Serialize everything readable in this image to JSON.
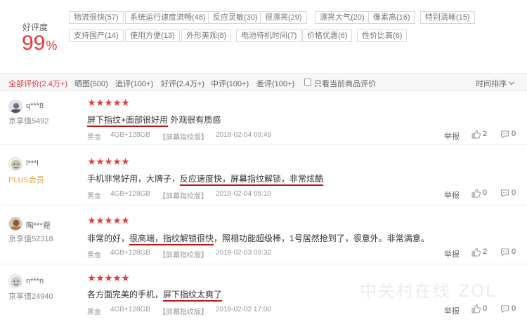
{
  "summary": {
    "rate_label": "好评度",
    "rate_value": "99",
    "rate_unit": "%",
    "tags": [
      {
        "label": "物流很快(57)"
      },
      {
        "label": "系统运行速度流畅(48)"
      },
      {
        "label": "反应灵敏(30)"
      },
      {
        "label": "很漂亮(29)"
      },
      {
        "label": "漂亮大气(20)"
      },
      {
        "label": "像素高(16)"
      },
      {
        "label": "特别清晰(15)"
      },
      {
        "label": "支持国产(14)"
      },
      {
        "label": "使用方便(13)"
      },
      {
        "label": "外形美观(8)"
      },
      {
        "label": "电池待机时间(7)"
      },
      {
        "label": "价格优惠(6)"
      },
      {
        "label": "性价比高(6)"
      }
    ]
  },
  "filters": {
    "all": "全部评价(2.4万+)",
    "photos": "晒图(500)",
    "followup": "追评(100+)",
    "good": "好评(2.4万+)",
    "medium": "中评(100+)",
    "bad": "差评(100+)",
    "current_only": "只看当前商品评价",
    "sort": "时间排序"
  },
  "reviews": [
    {
      "username": "q***8",
      "score": "京享值5492",
      "content_pre": "",
      "content_hl": "屏下指纹+面部很好用",
      "content_post": " 外观很有质感",
      "color": "黑金",
      "spec": "4GB+128GB",
      "edition": "【屏幕指纹版】",
      "date": "2018-02-04 09:49",
      "report": "举报",
      "likes": "2",
      "comments": "0"
    },
    {
      "username": "l***l",
      "score": "PLUS会员",
      "content_pre": "手机非常好用，大牌子，",
      "content_hl": "反应速度快，屏幕指纹解锁，非常炫酷",
      "content_post": "",
      "color": "黑金",
      "spec": "4GB+128GB",
      "edition": "【屏幕指纹版】",
      "date": "2018-02-04 05:10",
      "report": "举报",
      "likes": "0",
      "comments": "0"
    },
    {
      "username": "陶***菀",
      "score": "京享值52318",
      "content_pre": "非常的好，",
      "content_hl": "很高端，指纹解锁很快",
      "content_post": "，照相功能超级棒，1号居然抢到了，很意外。非常满意。",
      "color": "黑金",
      "spec": "4GB+128GB",
      "edition": "【屏幕指纹版】",
      "date": "2018-02-03 09:32",
      "report": "举报",
      "likes": "2",
      "comments": "0"
    },
    {
      "username": "n***n",
      "score": "京享值24940",
      "content_pre": "各方面完美的手机，",
      "content_hl": "屏下指纹太爽了",
      "content_post": "",
      "color": "黑金",
      "spec": "4GB+128GB",
      "edition": "【屏幕指纹版】",
      "date": "2018-02-02 17:00",
      "report": "举报",
      "likes": "0",
      "comments": "0"
    }
  ],
  "watermark": "中关村在线 ZOL",
  "colors": {
    "accent": "#e4393c",
    "underline": "#c0161a",
    "plus": "#e8a23a"
  }
}
